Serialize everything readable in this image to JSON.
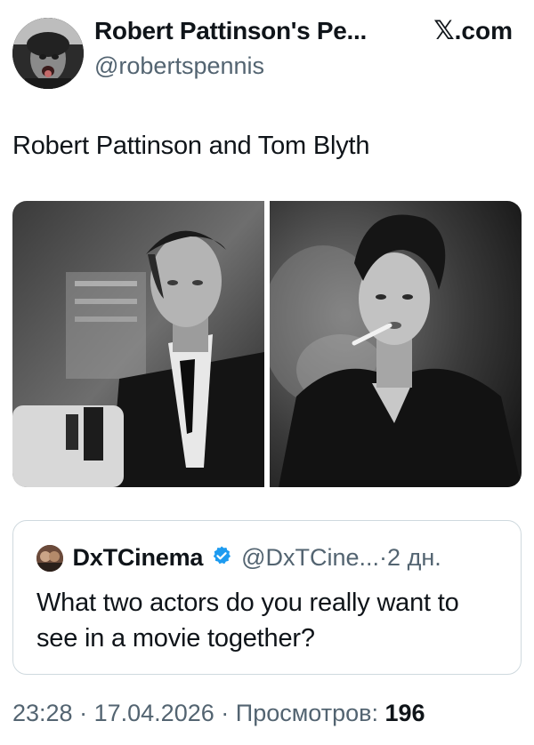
{
  "author": {
    "display_name": "Robert Pattinson's Pe...",
    "handle": "@robertspennis",
    "avatar": "avatar-photo"
  },
  "source": {
    "logo": "𝕏",
    "label": ".com"
  },
  "tweet": {
    "text": "Robert Pattinson and Tom Blyth",
    "media": [
      {
        "name": "photo-robert-pattinson",
        "style": "black-and-white"
      },
      {
        "name": "photo-tom-blyth",
        "style": "black-and-white"
      }
    ]
  },
  "quoted_tweet": {
    "display_name": "DxTCinema",
    "verified": true,
    "handle": "@DxTCine...",
    "separator": "·",
    "time": "2 дн.",
    "text": "What two actors do you really want to see in a movie together?"
  },
  "footer": {
    "time": "23:28",
    "separator": "·",
    "date": "17.04.2026",
    "separator2": "·",
    "views_label": "Просмотров:",
    "views_count": "196"
  },
  "colors": {
    "text": "#0f1419",
    "secondary": "#536471",
    "border": "#cfd9de",
    "verified": "#1d9bf0"
  }
}
